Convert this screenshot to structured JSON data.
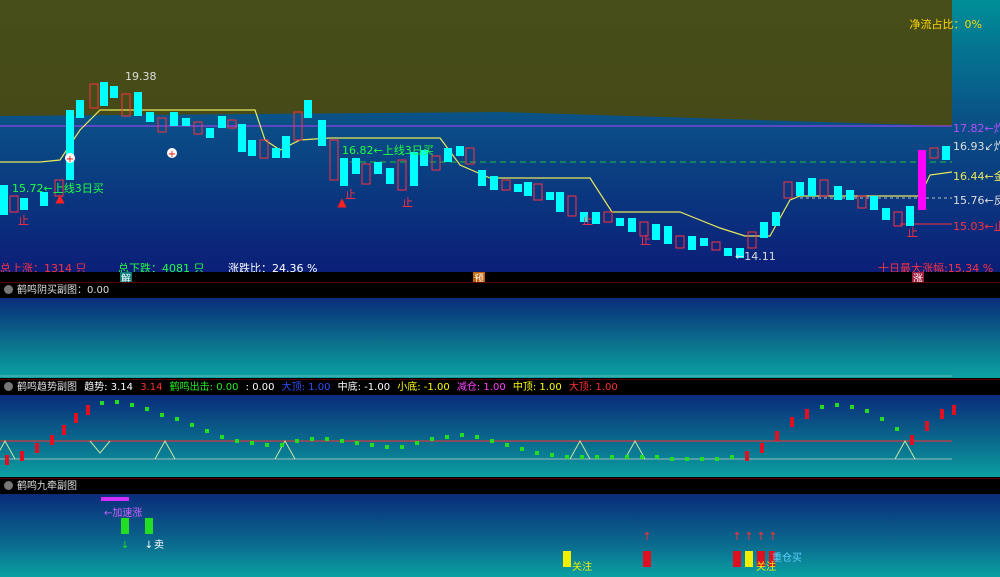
{
  "main": {
    "net_flow_label": "净流占比：0%",
    "price_labels": {
      "high_19_38": "19.38",
      "p17_82": "17.82←炸",
      "p16_93": "16.93↙炸",
      "p16_44": "16.44←金",
      "p15_76": "15.76←反",
      "p15_03": "15.03←止",
      "p14_11": "←14.11",
      "buy_left": "15.72←上线3日买",
      "buy_mid": "16.82←上线3日买",
      "stop": "止"
    },
    "stats": {
      "up_total": "总上涨：1314 只",
      "down_total": "总下跌：4081 只",
      "ratio": "涨跌比：24.36 %",
      "ten_day": "十日最大涨幅:15.34 %"
    },
    "markers": {
      "jie": "解",
      "yu": "预",
      "zhang": "涨"
    }
  },
  "sub1": {
    "title": "鹤鸣阴买副图：0.00"
  },
  "sub2": {
    "title": "鹤鸣趋势副图",
    "legend": [
      {
        "text": "趋势: 3.14",
        "color": "#ffffff"
      },
      {
        "text": "3.14",
        "color": "#ff3030"
      },
      {
        "text": "鹤鸣出击: 0.00",
        "color": "#22ee22"
      },
      {
        "text": ": 0.00",
        "color": "#ffffff"
      },
      {
        "text": "大顶: 1.00",
        "color": "#3050ff"
      },
      {
        "text": "中底: -1.00",
        "color": "#ffffff"
      },
      {
        "text": "小底: -1.00",
        "color": "#ffff00"
      },
      {
        "text": "减仓: 1.00",
        "color": "#ff40ff"
      },
      {
        "text": "中顶: 1.00",
        "color": "#ffff00"
      },
      {
        "text": "大顶: 1.00",
        "color": "#ff3030"
      }
    ]
  },
  "sub3": {
    "title": "鹤鸣九牵副图",
    "labels": {
      "sell": "卖",
      "watch1": "关注",
      "watch2": "关注",
      "heavy": "重仓买",
      "warn": "←加速涨"
    }
  },
  "colors": {
    "up": "#ff3040",
    "down": "#00ffff",
    "avg": "#e8e85a",
    "accent": "#ff00ff"
  }
}
